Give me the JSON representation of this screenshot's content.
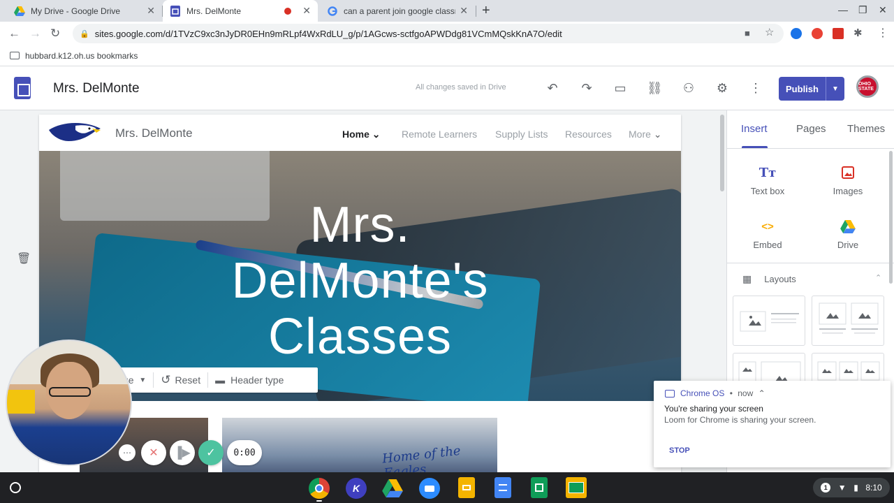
{
  "browser": {
    "tabs": [
      {
        "title": "My Drive - Google Drive",
        "icon": "google-drive-icon"
      },
      {
        "title": "Mrs. DelMonte",
        "icon": "google-sites-icon",
        "recording": true
      },
      {
        "title": "can a parent join google classro",
        "icon": "google-icon"
      }
    ],
    "url": "sites.google.com/d/1TVzC9xc3nJyDR0EHn9mRLpf4WxRdLU_g/p/1AGcws-sctfgoAPWDdg81VCmMQskKnA7O/edit",
    "bookmark": "hubbard.k12.oh.us bookmarks"
  },
  "sites": {
    "title": "Mrs. DelMonte",
    "save_status": "All changes saved in Drive",
    "publish_label": "Publish",
    "avatar_text": "OHIO STATE"
  },
  "site": {
    "name": "Mrs. DelMonte",
    "nav": [
      "Home",
      "Remote Learners",
      "Supply Lists",
      "Resources",
      "More"
    ],
    "hero_title_lines": [
      "Mrs.",
      "DelMonte's",
      "Classes"
    ],
    "hero_toolbar": {
      "image_label": "ge",
      "reset": "Reset",
      "header_type": "Header type"
    },
    "gallery_caption": "Home of the Eagles"
  },
  "panel": {
    "tabs": [
      "Insert",
      "Pages",
      "Themes"
    ],
    "insert_items": [
      {
        "label": "Text box",
        "icon": "text-box-icon"
      },
      {
        "label": "Images",
        "icon": "image-icon"
      },
      {
        "label": "Embed",
        "icon": "embed-icon"
      },
      {
        "label": "Drive",
        "icon": "google-drive-icon"
      }
    ],
    "layouts_label": "Layouts"
  },
  "notification": {
    "source": "Chrome OS",
    "time": "now",
    "title": "You're sharing your screen",
    "body": "Loom for Chrome is sharing your screen.",
    "action": "STOP"
  },
  "loom": {
    "timer": "0:00"
  },
  "shelf": {
    "apps": [
      "chrome",
      "k-app",
      "google-drive",
      "zoom",
      "google-slides",
      "google-docs",
      "google-sheets",
      "google-classroom"
    ],
    "notification_count": "1",
    "time": "8:10"
  },
  "colors": {
    "accent": "#4650b8",
    "tabstrip": "#dee1e6",
    "shelf": "#202124"
  }
}
